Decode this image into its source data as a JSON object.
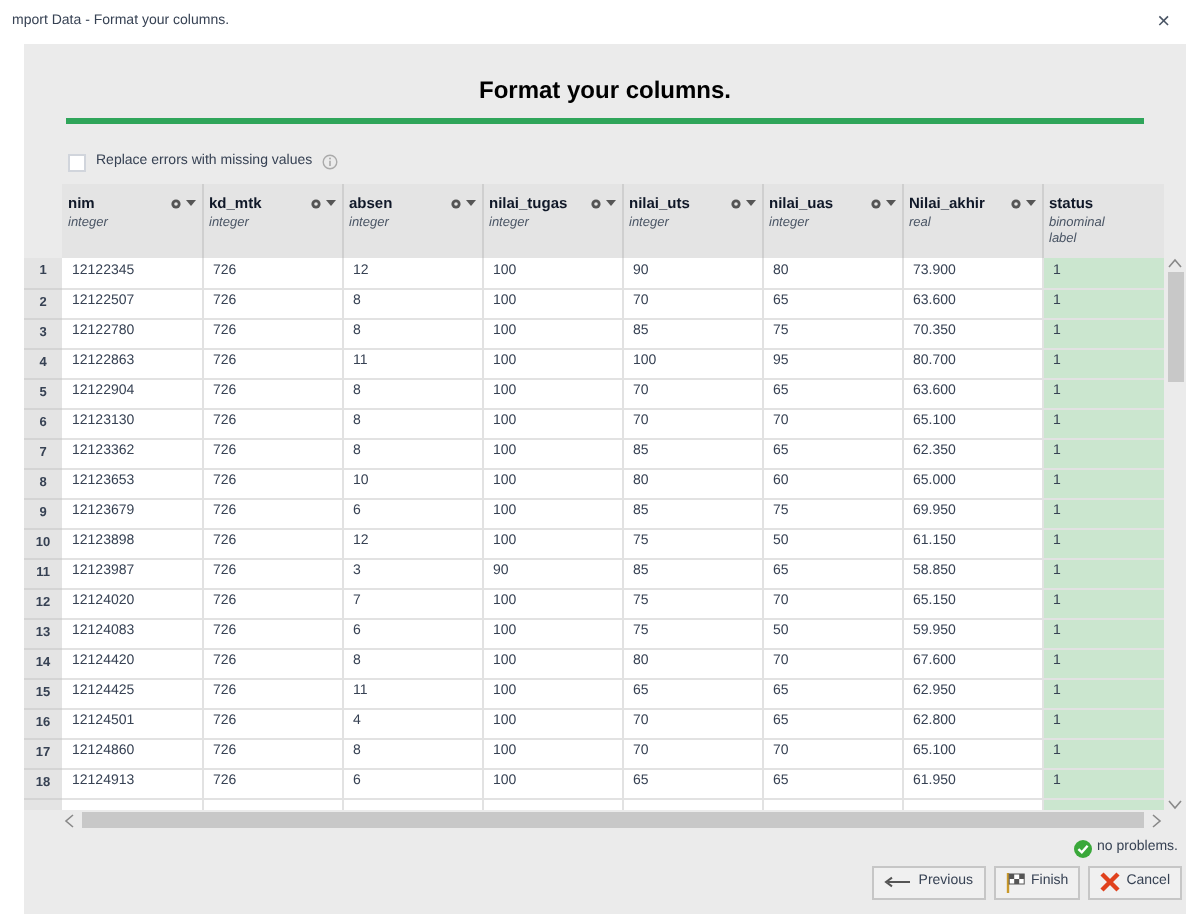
{
  "window": {
    "title": "mport Data - Format your columns.",
    "close": "×"
  },
  "heading": "Format your columns.",
  "progress": {
    "level": 1
  },
  "replace_errors": {
    "label": "Replace errors with missing values",
    "checked": false
  },
  "table": {
    "columns": [
      {
        "name": "nim",
        "type": "integer",
        "menu": true
      },
      {
        "name": "kd_mtk",
        "type": "integer",
        "menu": true
      },
      {
        "name": "absen",
        "type": "integer",
        "menu": true
      },
      {
        "name": "nilai_tugas",
        "type": "integer",
        "menu": true
      },
      {
        "name": "nilai_uts",
        "type": "integer",
        "menu": true
      },
      {
        "name": "nilai_uas",
        "type": "integer",
        "menu": true
      },
      {
        "name": "Nilai_akhir",
        "type": "real",
        "menu": true
      },
      {
        "name": "status",
        "type": "binominal",
        "role": "label",
        "menu": false
      }
    ],
    "rows": [
      {
        "number": "1",
        "cells": [
          "12122345",
          "726",
          "12",
          "100",
          "90",
          "80",
          "73.900",
          "1"
        ]
      },
      {
        "number": "2",
        "cells": [
          "12122507",
          "726",
          "8",
          "100",
          "70",
          "65",
          "63.600",
          "1"
        ]
      },
      {
        "number": "3",
        "cells": [
          "12122780",
          "726",
          "8",
          "100",
          "85",
          "75",
          "70.350",
          "1"
        ]
      },
      {
        "number": "4",
        "cells": [
          "12122863",
          "726",
          "11",
          "100",
          "100",
          "95",
          "80.700",
          "1"
        ]
      },
      {
        "number": "5",
        "cells": [
          "12122904",
          "726",
          "8",
          "100",
          "70",
          "65",
          "63.600",
          "1"
        ]
      },
      {
        "number": "6",
        "cells": [
          "12123130",
          "726",
          "8",
          "100",
          "70",
          "70",
          "65.100",
          "1"
        ]
      },
      {
        "number": "7",
        "cells": [
          "12123362",
          "726",
          "8",
          "100",
          "85",
          "65",
          "62.350",
          "1"
        ]
      },
      {
        "number": "8",
        "cells": [
          "12123653",
          "726",
          "10",
          "100",
          "80",
          "60",
          "65.000",
          "1"
        ]
      },
      {
        "number": "9",
        "cells": [
          "12123679",
          "726",
          "6",
          "100",
          "85",
          "75",
          "69.950",
          "1"
        ]
      },
      {
        "number": "10",
        "cells": [
          "12123898",
          "726",
          "12",
          "100",
          "75",
          "50",
          "61.150",
          "1"
        ]
      },
      {
        "number": "11",
        "cells": [
          "12123987",
          "726",
          "3",
          "90",
          "85",
          "65",
          "58.850",
          "1"
        ]
      },
      {
        "number": "12",
        "cells": [
          "12124020",
          "726",
          "7",
          "100",
          "75",
          "70",
          "65.150",
          "1"
        ]
      },
      {
        "number": "13",
        "cells": [
          "12124083",
          "726",
          "6",
          "100",
          "75",
          "50",
          "59.950",
          "1"
        ]
      },
      {
        "number": "14",
        "cells": [
          "12124420",
          "726",
          "8",
          "100",
          "80",
          "70",
          "67.600",
          "1"
        ]
      },
      {
        "number": "15",
        "cells": [
          "12124425",
          "726",
          "11",
          "100",
          "65",
          "65",
          "62.950",
          "1"
        ]
      },
      {
        "number": "16",
        "cells": [
          "12124501",
          "726",
          "4",
          "100",
          "70",
          "65",
          "62.800",
          "1"
        ]
      },
      {
        "number": "17",
        "cells": [
          "12124860",
          "726",
          "8",
          "100",
          "70",
          "70",
          "65.100",
          "1"
        ]
      },
      {
        "number": "18",
        "cells": [
          "12124913",
          "726",
          "6",
          "100",
          "65",
          "65",
          "61.950",
          "1"
        ]
      }
    ]
  },
  "status": "no problems.",
  "buttons": [
    {
      "kind": "previous",
      "label": "Previous"
    },
    {
      "kind": "finish",
      "label": "Finish"
    },
    {
      "kind": "cancel",
      "label": "Cancel"
    }
  ]
}
